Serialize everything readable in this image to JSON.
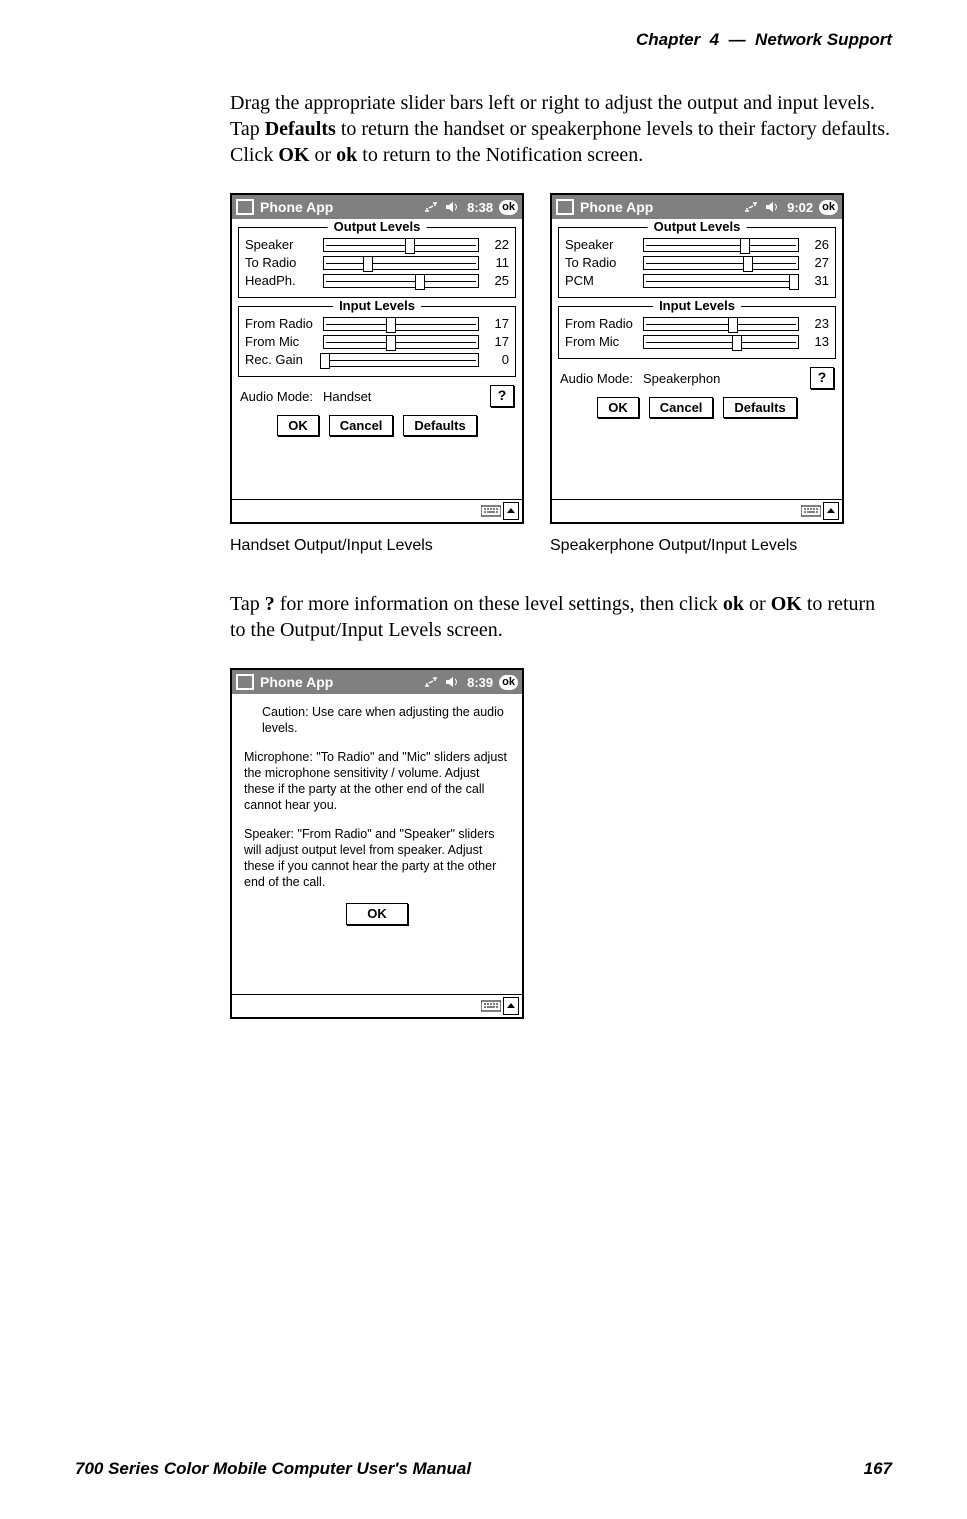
{
  "header": {
    "chapter_label": "Chapter",
    "chapter_number": "4",
    "separator": "—",
    "chapter_title": "Network Support"
  },
  "para1_a": "Drag the appropriate slider bars left  or right to adjust the output and input levels. Tap ",
  "para1_bold1": "Defaults",
  "para1_b": " to return the handset or speakerphone levels to their factory defaults. Click ",
  "para1_bold2": "OK",
  "para1_c": " or ",
  "para1_bold3": "ok",
  "para1_d": " to return to the Notification screen.",
  "screens": {
    "handset": {
      "title_app": "Phone App",
      "time": "8:38",
      "ok": "ok",
      "output_legend": "Output Levels",
      "input_legend": "Input Levels",
      "output_rows": [
        {
          "label": "Speaker",
          "value": "22",
          "pct": 55
        },
        {
          "label": "To Radio",
          "value": "11",
          "pct": 28
        },
        {
          "label": "HeadPh.",
          "value": "25",
          "pct": 62
        }
      ],
      "input_rows": [
        {
          "label": "From Radio",
          "value": "17",
          "pct": 43
        },
        {
          "label": "From Mic",
          "value": "17",
          "pct": 43
        },
        {
          "label": "Rec. Gain",
          "value": "0",
          "pct": 0
        }
      ],
      "mode_label": "Audio Mode:",
      "mode_value": "Handset",
      "help_btn": "?",
      "buttons": {
        "ok": "OK",
        "cancel": "Cancel",
        "defaults": "Defaults"
      },
      "caption": "Handset Output/Input Levels"
    },
    "speaker": {
      "title_app": "Phone App",
      "time": "9:02",
      "ok": "ok",
      "output_legend": "Output Levels",
      "input_legend": "Input Levels",
      "output_rows": [
        {
          "label": "Speaker",
          "value": "26",
          "pct": 65
        },
        {
          "label": "To Radio",
          "value": "27",
          "pct": 67
        },
        {
          "label": "PCM",
          "value": "31",
          "pct": 97
        }
      ],
      "input_rows": [
        {
          "label": "From Radio",
          "value": "23",
          "pct": 57
        },
        {
          "label": "From Mic",
          "value": "13",
          "pct": 60
        }
      ],
      "mode_label": "Audio Mode:",
      "mode_value": "Speakerphon",
      "help_btn": "?",
      "buttons": {
        "ok": "OK",
        "cancel": "Cancel",
        "defaults": "Defaults"
      },
      "caption": "Speakerphone Output/Input Levels"
    },
    "help": {
      "title_app": "Phone App",
      "time": "8:39",
      "ok": "ok",
      "p1": "Caution:  Use care when adjusting the audio levels.",
      "p2": "Microphone:  \"To Radio\" and \"Mic\" sliders adjust the microphone sensitivity / volume.  Adjust these if the party at the other end of the call cannot hear you.",
      "p3": "Speaker:  \"From Radio\" and \"Speaker\" sliders will adjust output level from speaker.  Adjust these if you cannot hear the party at the other end of the call.",
      "ok_btn": "OK"
    }
  },
  "para2_a": "Tap ",
  "para2_bold1": "?",
  "para2_b": " for more information on these level settings, then click ",
  "para2_bold2": "ok",
  "para2_c": " or ",
  "para2_bold3": "OK",
  "para2_d": " to return to the Output/Input Levels screen.",
  "footer": {
    "manual_title": "700 Series Color Mobile Computer User's Manual",
    "page_number": "167"
  }
}
